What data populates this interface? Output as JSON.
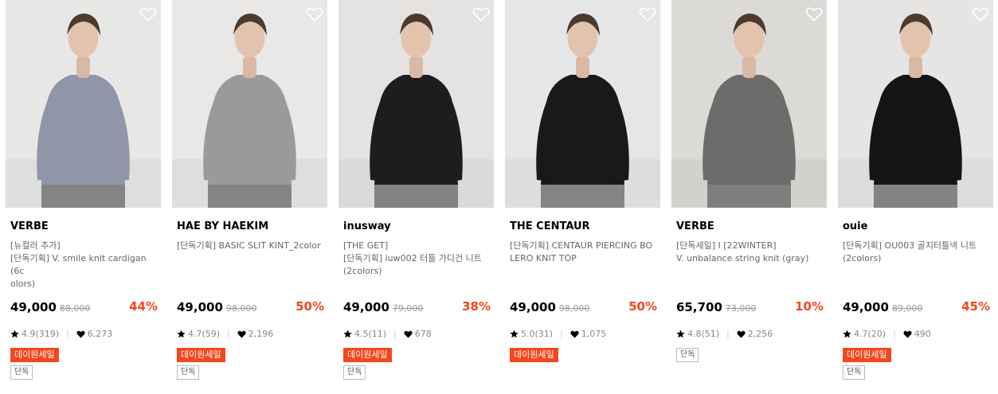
{
  "products": [
    {
      "brand": "VERBE",
      "line1": "[뉴컬러 추가]",
      "line2": "[단독기획] V. smile knit cardigan (6c",
      "line3": "olors)",
      "price": "49,000",
      "original_price": "88,000",
      "discount": "44%",
      "rating": "4.9(319)",
      "likes": "6,273",
      "sale_badge": "데이원세일",
      "tag": "단독",
      "photo_bg": "#e7e8e6",
      "garment_color": "#8e96a8"
    },
    {
      "brand": "HAE BY HAEKIM",
      "line1": "[단독기획] BASIC SLIT KINT_2color",
      "line2": "",
      "line3": "",
      "price": "49,000",
      "original_price": "98,000",
      "discount": "50%",
      "rating": "4.7(59)",
      "likes": "2,196",
      "sale_badge": "데이원세일",
      "tag": "단독",
      "photo_bg": "#e9e8e6",
      "garment_color": "#9c9a98"
    },
    {
      "brand": "inusway",
      "line1": "[THE GET]",
      "line2": "[단독기획] iuw002 터틀 가디건 니트",
      "line3": "(2colors)",
      "price": "49,000",
      "original_price": "79,000",
      "discount": "38%",
      "rating": "4.5(11)",
      "likes": "678",
      "sale_badge": "데이원세일",
      "tag": "단독",
      "photo_bg": "#e4e3e1",
      "garment_color": "#1e1c1f"
    },
    {
      "brand": "THE CENTAUR",
      "line1": "[단독기획] CENTAUR PIERCING BO",
      "line2": "LERO KNIT TOP",
      "line3": "",
      "price": "49,000",
      "original_price": "98,000",
      "discount": "50%",
      "rating": "5.0(31)",
      "likes": "1,075",
      "sale_badge": "데이원세일",
      "tag": "",
      "photo_bg": "#e5e6e8",
      "garment_color": "#19191b"
    },
    {
      "brand": "VERBE",
      "line1": "[단독세일] I [22WINTER]",
      "line2": "V. unbalance string knit (gray)",
      "line3": "",
      "price": "65,700",
      "original_price": "73,000",
      "discount": "10%",
      "rating": "4.8(51)",
      "likes": "2,256",
      "sale_badge": "",
      "tag": "단독",
      "photo_bg": "#dcdad6",
      "garment_color": "#6d6c6b"
    },
    {
      "brand": "ouie",
      "line1": "[단독기획] OU003 골지터틀넥 니트",
      "line2": "(2colors)",
      "line3": "",
      "price": "49,000",
      "original_price": "89,000",
      "discount": "45%",
      "rating": "4.7(20)",
      "likes": "490",
      "sale_badge": "데이원세일",
      "tag": "단독",
      "photo_bg": "#e6e5e4",
      "garment_color": "#151416"
    }
  ],
  "colors": {
    "accent": "#f5461c",
    "muted_text": "#666666",
    "strike_text": "#999999"
  }
}
